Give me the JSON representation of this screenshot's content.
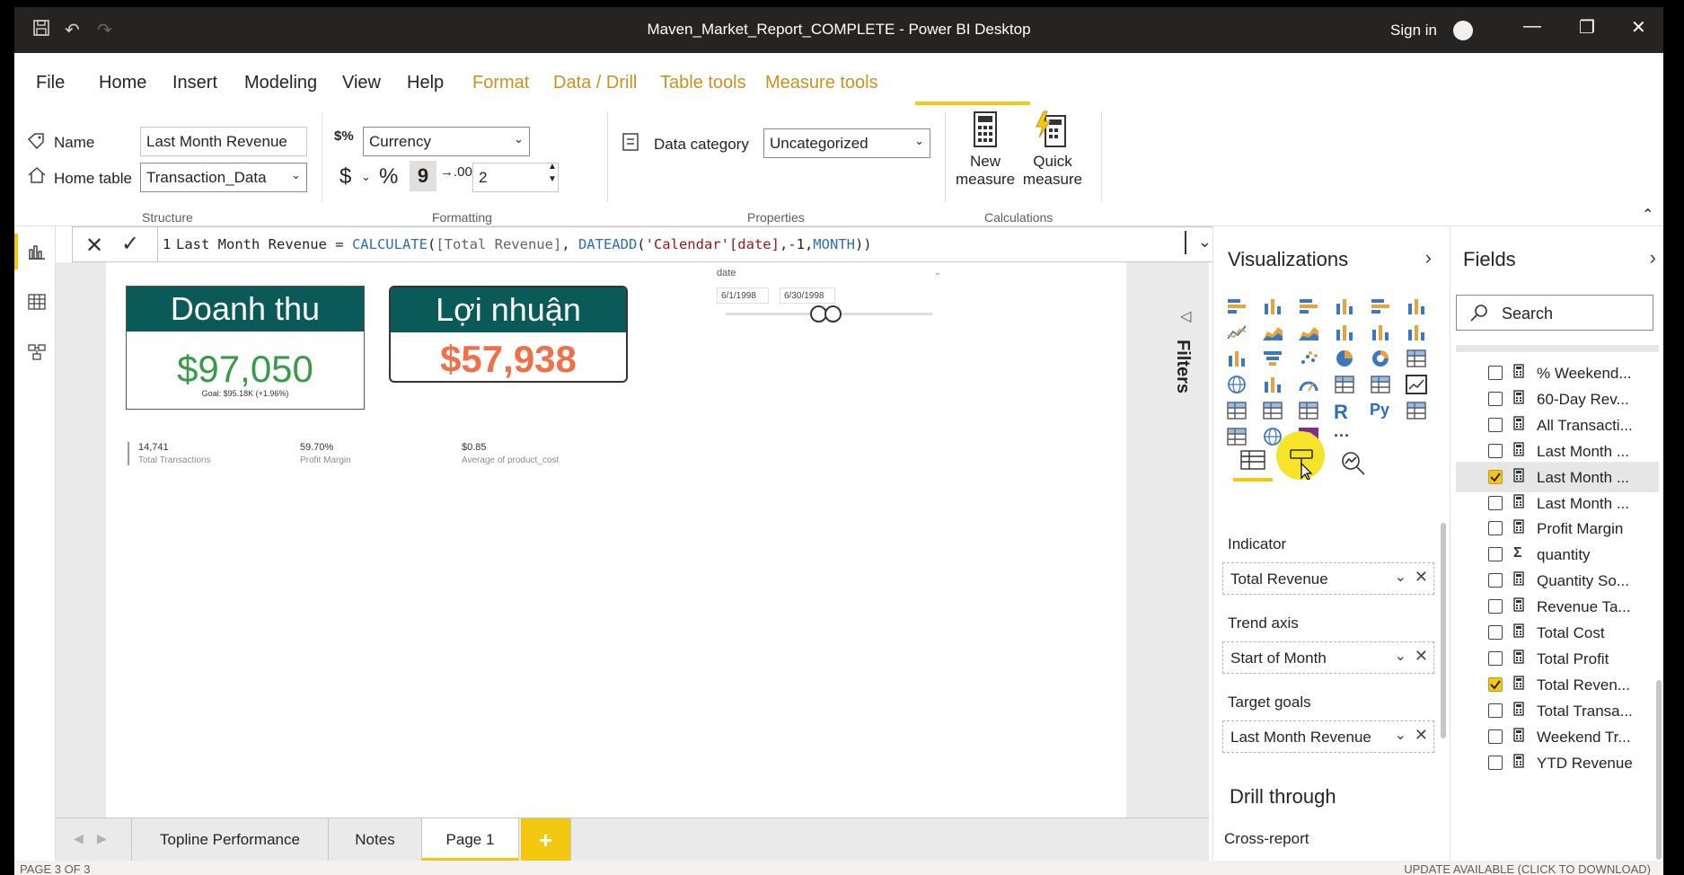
{
  "window": {
    "title": "Maven_Market_Report_COMPLETE - Power BI Desktop",
    "sign_in": "Sign in"
  },
  "menu": {
    "file": "File",
    "home": "Home",
    "insert": "Insert",
    "modeling": "Modeling",
    "view": "View",
    "help": "Help",
    "format": "Format",
    "data_drill": "Data / Drill",
    "table_tools": "Table tools",
    "measure_tools": "Measure tools"
  },
  "ribbon": {
    "name_label": "Name",
    "name_value": "Last Month Revenue",
    "home_table_label": "Home table",
    "home_table_value": "Transaction_Data",
    "structure": "Structure",
    "format_value": "Currency",
    "dollar": "$",
    "percent": "%",
    "comma": "9",
    "decimals": "2",
    "formatting": "Formatting",
    "data_category_label": "Data category",
    "data_category_value": "Uncategorized",
    "properties": "Properties",
    "new_measure": [
      "New",
      "measure"
    ],
    "quick_measure": [
      "Quick",
      "measure"
    ],
    "calculations": "Calculations"
  },
  "formula": {
    "line_no": "1",
    "p1": "Last Month Revenue = ",
    "fn1": "CALCULATE",
    "p2": "(",
    "ref1": "[Total Revenue]",
    "p3": ", ",
    "fn2": "DATEADD",
    "p4": "(",
    "str1": "'Calendar'[date]",
    "p5": ",-1,",
    "fn3": "MONTH",
    "p6": "))"
  },
  "cards": {
    "revenue_title": "Doanh thu",
    "revenue_value": "$97,050",
    "revenue_goal": "Goal: $95.18K (+1.96%)",
    "profit_title": "Lợi nhuận",
    "profit_value": "$57,938",
    "colors": {
      "header": "#0b5a5a",
      "revenue": "#3a9a4a",
      "profit": "#f0704a"
    }
  },
  "kpis": [
    {
      "value": "14,741",
      "label": "Total Transactions"
    },
    {
      "value": "59.70%",
      "label": "Profit Margin"
    },
    {
      "value": "$0.85",
      "label": "Average of product_cost"
    }
  ],
  "slicer": {
    "title": "date",
    "start": "6/1/1998",
    "end": "6/30/1998"
  },
  "filters_label": "Filters",
  "visualizations": {
    "title": "Visualizations",
    "indicator_label": "Indicator",
    "indicator_value": "Total Revenue",
    "trend_label": "Trend axis",
    "trend_value": "Start of Month",
    "target_label": "Target goals",
    "target_value": "Last Month Revenue",
    "drill_through": "Drill through",
    "cross_report": "Cross-report",
    "r_label": "R",
    "py_label": "Py",
    "more": "···"
  },
  "fields": {
    "title": "Fields",
    "search_placeholder": "Search",
    "items": [
      {
        "name": "% Weekend...",
        "checked": false,
        "icon": "calc"
      },
      {
        "name": "60-Day Rev...",
        "checked": false,
        "icon": "calc"
      },
      {
        "name": "All Transacti...",
        "checked": false,
        "icon": "calc"
      },
      {
        "name": "Last Month ...",
        "checked": false,
        "icon": "calc"
      },
      {
        "name": "Last Month ...",
        "checked": true,
        "icon": "calc"
      },
      {
        "name": "Last Month ...",
        "checked": false,
        "icon": "calc"
      },
      {
        "name": "Profit Margin",
        "checked": false,
        "icon": "calc"
      },
      {
        "name": "quantity",
        "checked": false,
        "icon": "sigma"
      },
      {
        "name": "Quantity So...",
        "checked": false,
        "icon": "calc"
      },
      {
        "name": "Revenue Ta...",
        "checked": false,
        "icon": "calc"
      },
      {
        "name": "Total Cost",
        "checked": false,
        "icon": "calc"
      },
      {
        "name": "Total Profit",
        "checked": false,
        "icon": "calc"
      },
      {
        "name": "Total Reven...",
        "checked": true,
        "icon": "calc"
      },
      {
        "name": "Total Transa...",
        "checked": false,
        "icon": "calc"
      },
      {
        "name": "Weekend Tr...",
        "checked": false,
        "icon": "calc"
      },
      {
        "name": "YTD Revenue",
        "checked": false,
        "icon": "calc"
      }
    ]
  },
  "pages": {
    "tab1": "Topline Performance",
    "tab2": "Notes",
    "tab3": "Page 1",
    "add": "+"
  },
  "status": {
    "page": "PAGE 3 OF 3",
    "update": "UPDATE AVAILABLE (CLICK TO DOWNLOAD)"
  }
}
